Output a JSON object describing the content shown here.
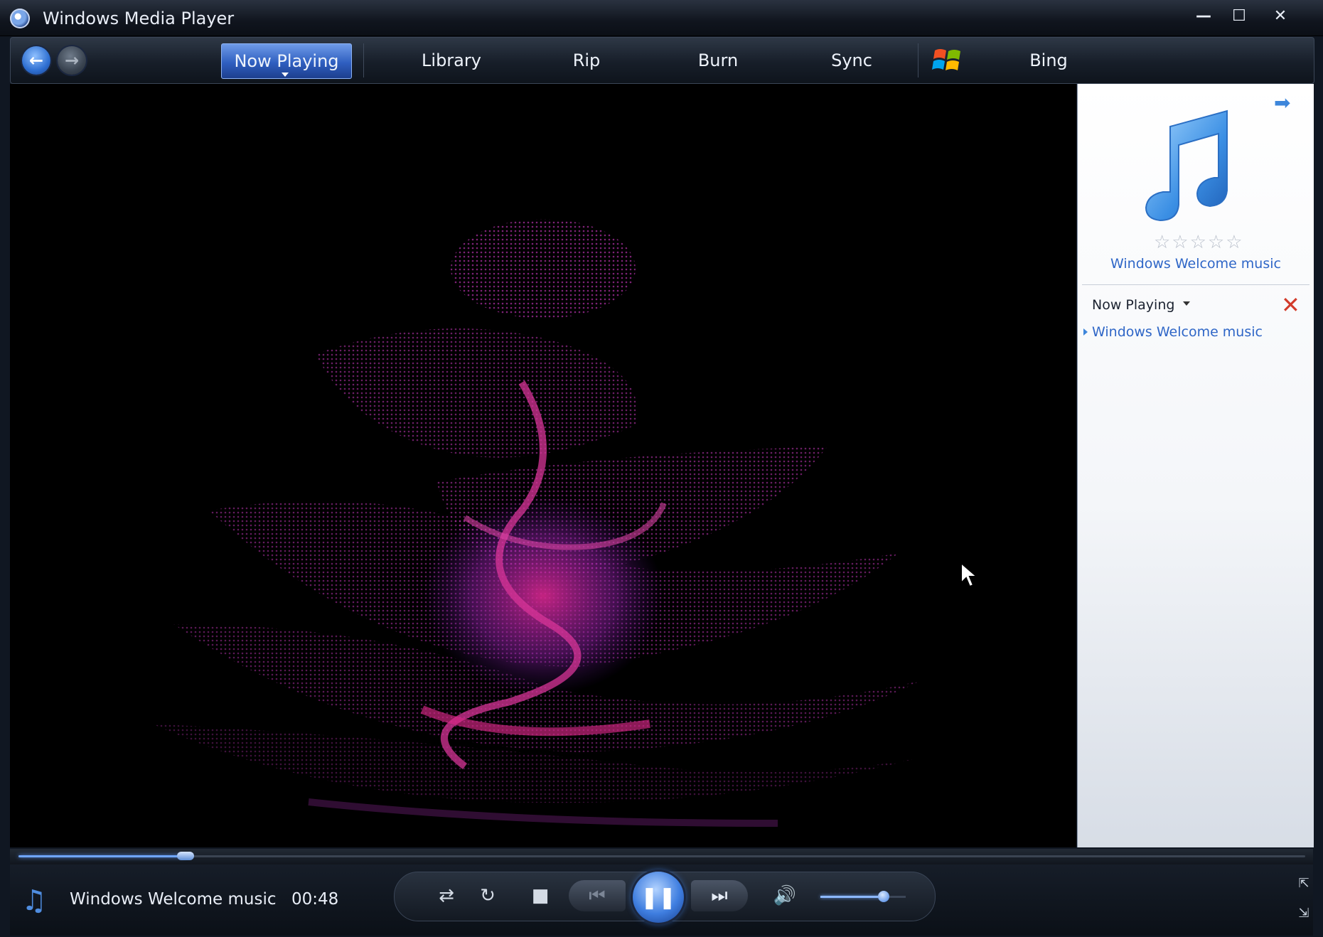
{
  "window": {
    "title": "Windows Media Player",
    "min_symbol": "—",
    "max_symbol": "☐",
    "close_symbol": "✕"
  },
  "nav": {
    "back_symbol": "←",
    "forward_symbol": "→",
    "tabs": [
      {
        "label": "Now Playing",
        "active": true
      },
      {
        "label": "Library"
      },
      {
        "label": "Rip"
      },
      {
        "label": "Burn"
      },
      {
        "label": "Sync"
      },
      {
        "label": "Bing"
      }
    ]
  },
  "panel": {
    "arrow_symbol": "➡",
    "stars": "☆☆☆☆☆",
    "album_title": "Windows Welcome music",
    "now_playing_label": "Now Playing",
    "clear_symbol": "✕",
    "playlist": [
      {
        "title": "Windows Welcome music"
      }
    ]
  },
  "playback": {
    "progress_fraction": 0.13,
    "volume_fraction": 0.74,
    "current_title": "Windows Welcome music",
    "current_time": "00:48",
    "status_icon": "♫",
    "shuffle_symbol": "⇄",
    "repeat_symbol": "↻",
    "stop_symbol": "■",
    "prev_symbol": "⏮",
    "pause_symbol": "❚❚",
    "next_symbol": "⏭",
    "mute_symbol": "🔊",
    "view_switch_symbol": "⇱",
    "compact_symbol": "⇲"
  },
  "colors": {
    "accent": "#3f7ee0",
    "viz_core": "#ff2fa8",
    "viz_edge": "#8a3cd6",
    "link": "#2e66c7"
  }
}
